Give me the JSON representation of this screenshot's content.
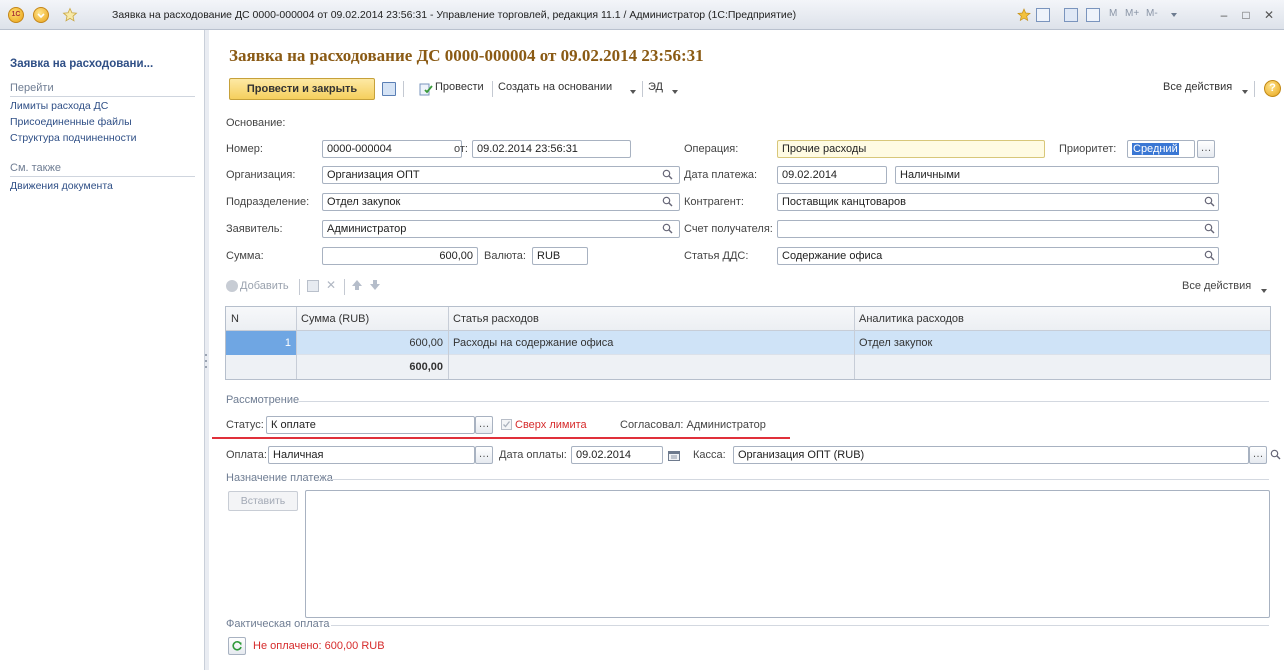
{
  "window": {
    "title": "Заявка на расходование ДС 0000-000004 от 09.02.2014 23:56:31 - Управление торговлей, редакция 11.1 / Администратор  (1С:Предприятие)",
    "mem_buttons": [
      "M",
      "M+",
      "M-"
    ],
    "controls": {
      "minimize": "–",
      "maximize": "□",
      "close": "✕"
    },
    "app_badge": "1С"
  },
  "nav": {
    "title": "Заявка на расходовани...",
    "goto_header": "Перейти",
    "goto_items": [
      "Лимиты расхода ДС",
      "Присоединенные файлы",
      "Структура подчиненности"
    ],
    "see_also_header": "См. также",
    "see_also_items": [
      "Движения документа"
    ]
  },
  "doc": {
    "title": "Заявка на расходование ДС 0000-000004 от 09.02.2014 23:56:31"
  },
  "toolbar": {
    "post_close": "Провести и закрыть",
    "post": "Провести",
    "create_based": "Создать на основании",
    "ed": "ЭД",
    "all_actions": "Все действия",
    "help": "?"
  },
  "form": {
    "basis_label": "Основание:",
    "number_label": "Номер:",
    "number_value": "0000-000004",
    "from_label": "от:",
    "from_value": "09.02.2014 23:56:31",
    "operation_label": "Операция:",
    "operation_value": "Прочие расходы",
    "priority_label": "Приоритет:",
    "priority_value": "Средний",
    "org_label": "Организация:",
    "org_value": "Организация ОПТ",
    "paydate_label": "Дата платежа:",
    "paydate_value": "09.02.2014",
    "paytype_value": "Наличными",
    "dept_label": "Подразделение:",
    "dept_value": "Отдел закупок",
    "contractor_label": "Контрагент:",
    "contractor_value": "Поставщик канцтоваров",
    "applicant_label": "Заявитель:",
    "applicant_value": "Администратор",
    "account_label": "Счет получателя:",
    "account_value": "",
    "sum_label": "Сумма:",
    "sum_value": "600,00",
    "currency_label": "Валюта:",
    "currency_value": "RUB",
    "dds_label": "Статья ДДС:",
    "dds_value": "Содержание офиса"
  },
  "table_toolbar": {
    "add": "Добавить",
    "all_actions": "Все действия"
  },
  "table": {
    "headers": [
      "N",
      "Сумма (RUB)",
      "Статья расходов",
      "Аналитика расходов"
    ],
    "rows": [
      {
        "n": "1",
        "sum": "600,00",
        "item": "Расходы на содержание офиса",
        "analytics": "Отдел закупок"
      }
    ],
    "total": "600,00"
  },
  "review": {
    "section": "Рассмотрение",
    "status_label": "Статус:",
    "status_value": "К оплате",
    "over_limit": "Сверх лимита",
    "approved": "Согласовал: Администратор"
  },
  "payment": {
    "pay_label": "Оплата:",
    "pay_value": "Наличная",
    "paydate_label": "Дата оплаты:",
    "paydate_value": "09.02.2014",
    "cash_label": "Касса:",
    "cash_value": "Организация ОПТ (RUB)"
  },
  "purpose": {
    "section": "Назначение платежа",
    "insert": "Вставить"
  },
  "actual": {
    "section": "Фактическая оплата",
    "status": "Не оплачено: 600,00 RUB"
  },
  "colors": {
    "title_brown": "#8a5a14",
    "link_blue": "#2f4f86",
    "primary_button": "#f5cf5d",
    "selected_row": "#cfe3f7",
    "alert_red": "#d62b2b"
  }
}
